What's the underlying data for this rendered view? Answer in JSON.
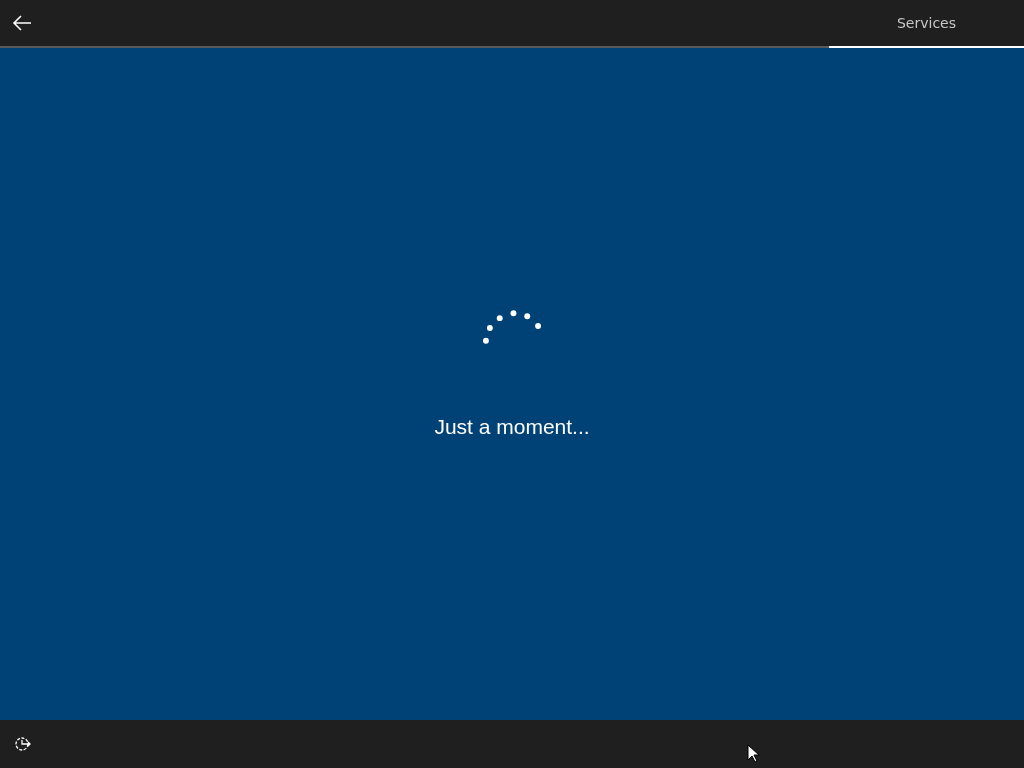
{
  "top_bar": {
    "tabs": [
      {
        "label": "Services",
        "selected": true
      }
    ]
  },
  "message": "Just a moment..."
}
